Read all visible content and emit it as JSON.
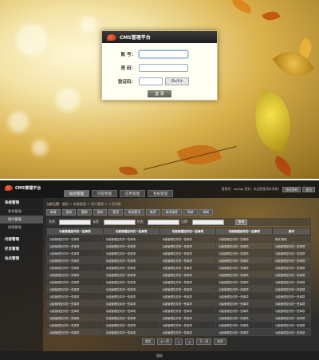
{
  "login": {
    "title": "CMS管理平台",
    "username_label": "账 号：",
    "password_label": "密 码：",
    "captcha_label": "验证码：",
    "captcha_text": "8uiVx",
    "submit_label": "登 录"
  },
  "admin": {
    "brand": "CMS管理平台",
    "nav_tabs": [
      "站点管理",
      "内容管理",
      "应用管理",
      "系统管理"
    ],
    "user_info": "管理员：zodiog 您好，欢迎您使用本系统！",
    "top_buttons": [
      "修改密码",
      "退出"
    ],
    "sidebar": [
      {
        "label": "系统管理",
        "type": "group"
      },
      {
        "label": "角色管理",
        "type": "item"
      },
      {
        "label": "用户管理",
        "type": "item"
      },
      {
        "label": "权限管理",
        "type": "item"
      },
      {
        "label": "内容管理",
        "type": "group"
      },
      {
        "label": "栏目管理",
        "type": "group"
      },
      {
        "label": "站点管理",
        "type": "group"
      }
    ],
    "breadcrumb": {
      "home": "当前位置：首页",
      "sep": ">",
      "path": [
        "系统管理",
        "用户管理",
        "人员列表"
      ]
    },
    "toolbar": [
      "新增",
      "修改",
      "删除",
      "发布",
      "置顶",
      "取消置顶",
      "推荐",
      "取消推荐",
      "审核",
      "刷新"
    ],
    "search": {
      "label1": "名称：",
      "label2": "标签：",
      "label3": "状态：",
      "label4": "日期：",
      "button": "查询"
    },
    "table": {
      "headers": [
        "功能管理控件的一些事项",
        "功能管理控件的一些事项",
        "功能管理控件的一些事项",
        "功能管理控件的一些事项",
        "操作"
      ],
      "cell_text": "功能管理控件的一些事项",
      "ops_text": "修改  删除",
      "row_count": 14
    },
    "pager": [
      "首页",
      "上一页",
      "1",
      "2",
      "下一页",
      "末页"
    ],
    "footer": "版权"
  }
}
